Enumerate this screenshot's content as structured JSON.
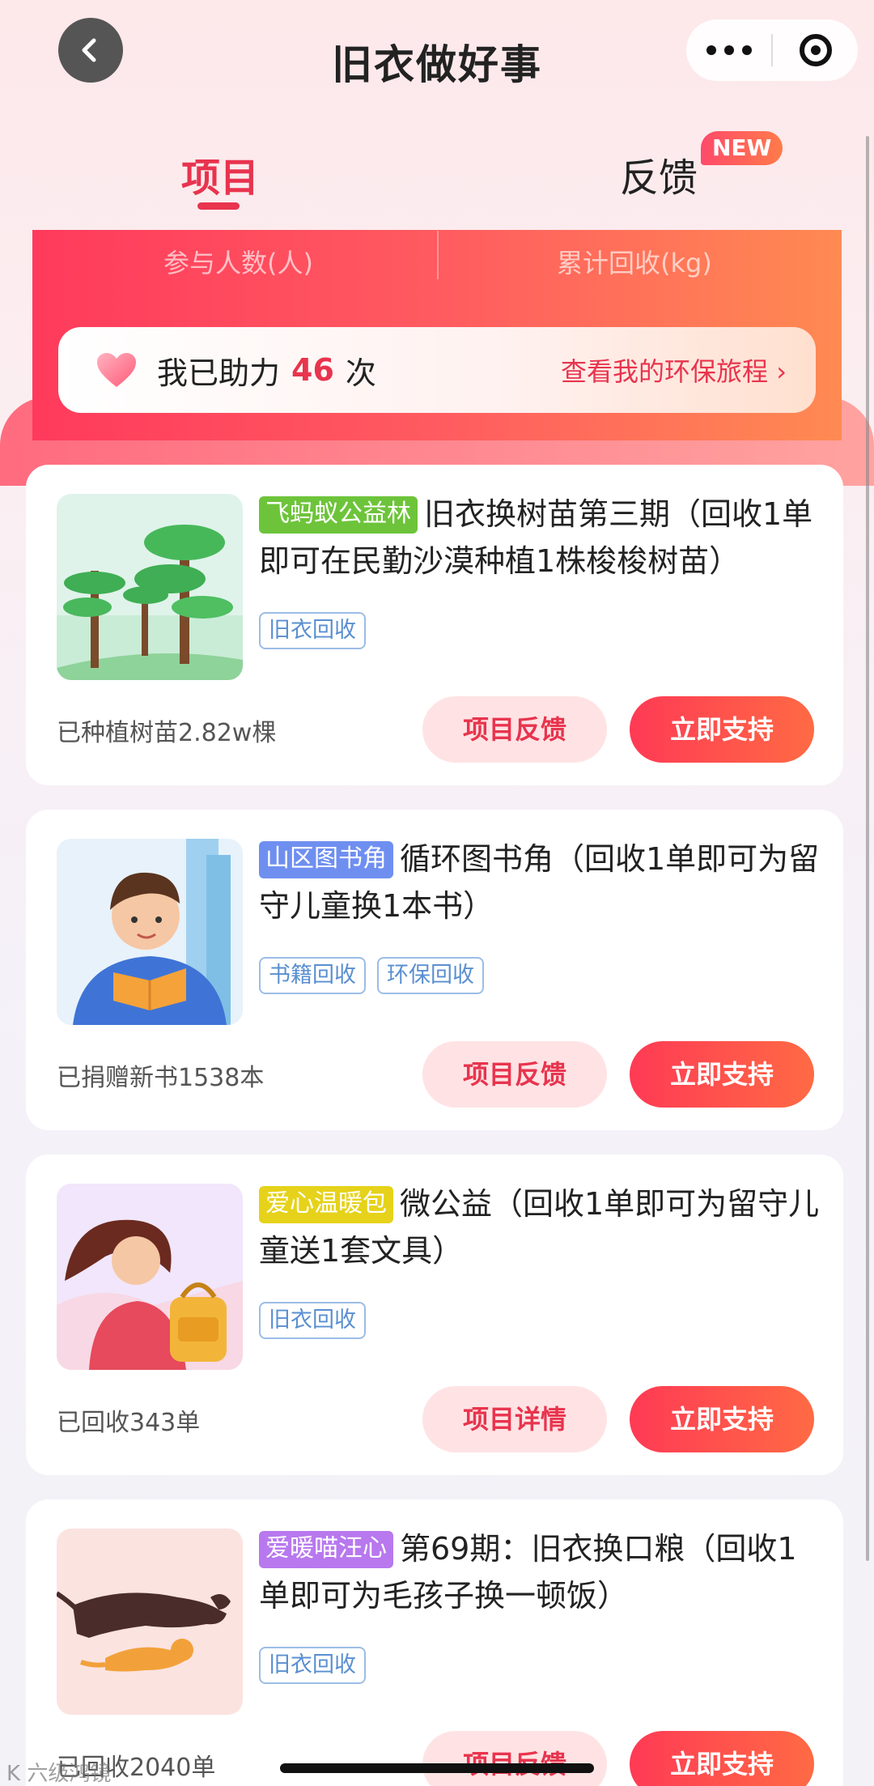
{
  "nav": {
    "title": "旧衣做好事"
  },
  "tabs": {
    "project": "项目",
    "feedback": "反馈",
    "new_badge": "NEW"
  },
  "stats": {
    "participants_label": "参与人数(人)",
    "recycled_label": "累计回收(kg)",
    "helped_prefix": "我已助力",
    "helped_count": "46",
    "helped_suffix": "次",
    "journey_link": "查看我的环保旅程 ›"
  },
  "cards": [
    {
      "badge": "飞蚂蚁公益林",
      "badge_color": "#6dc43a",
      "title": "旧衣换树苗第三期（回收1单即可在民勤沙漠种植1株梭梭树苗）",
      "tags": [
        "旧衣回收"
      ],
      "stat": "已种植树苗2.82w棵",
      "secondary_button": "项目反馈",
      "primary_button": "立即支持"
    },
    {
      "badge": "山区图书角",
      "badge_color": "#6f8ff0",
      "title": "循环图书角（回收1单即可为留守儿童换1本书）",
      "tags": [
        "书籍回收",
        "环保回收"
      ],
      "stat": "已捐赠新书1538本",
      "secondary_button": "项目反馈",
      "primary_button": "立即支持"
    },
    {
      "badge": "爱心温暖包",
      "badge_color": "#e6d21a",
      "title": "微公益（回收1单即可为留守儿童送1套文具）",
      "tags": [
        "旧衣回收"
      ],
      "stat": "已回收343单",
      "secondary_button": "项目详情",
      "primary_button": "立即支持"
    },
    {
      "badge": "爱暖喵汪心",
      "badge_color": "#b878ee",
      "title": "第69期：旧衣换口粮（回收1单即可为毛孩子换一顿饭）",
      "tags": [
        "旧衣回收"
      ],
      "stat": "已回收2040单",
      "secondary_button": "项目反馈",
      "primary_button": "立即支持"
    }
  ],
  "watermark": "K 六级鸿镜",
  "colors": {
    "accent": "#e8344e",
    "tag": "#5a8fd0"
  }
}
